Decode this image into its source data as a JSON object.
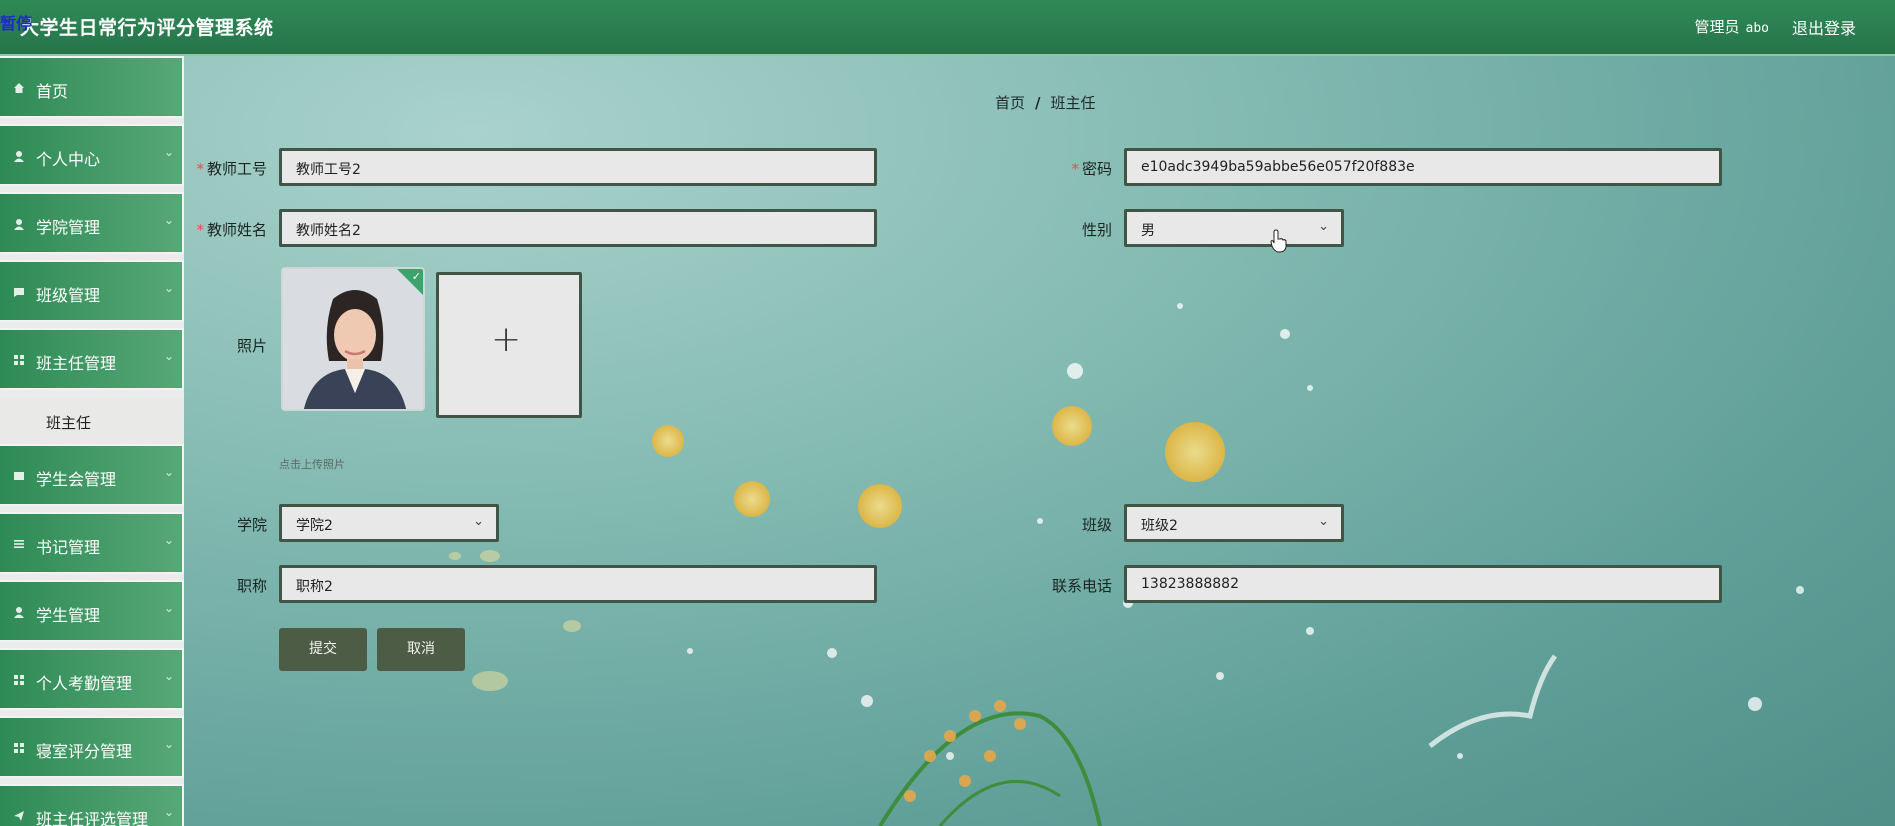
{
  "app": {
    "badge": "暂停",
    "title": "大学生日常行为评分管理系统",
    "user_role": "管理员",
    "user_name": "abo",
    "logout": "退出登录"
  },
  "sidebar": {
    "items": [
      {
        "label": "首页",
        "icon": "home-icon"
      },
      {
        "label": "个人中心",
        "icon": "user-icon"
      },
      {
        "label": "学院管理",
        "icon": "user-icon"
      },
      {
        "label": "班级管理",
        "icon": "chat-icon"
      },
      {
        "label": "班主任管理",
        "icon": "grid-icon"
      },
      {
        "label": "学生会管理",
        "icon": "card-icon"
      },
      {
        "label": "书记管理",
        "icon": "menu-icon"
      },
      {
        "label": "学生管理",
        "icon": "user-icon"
      },
      {
        "label": "个人考勤管理",
        "icon": "grid-icon"
      },
      {
        "label": "寝室评分管理",
        "icon": "grid-icon"
      },
      {
        "label": "班主任评选管理",
        "icon": "send-icon"
      }
    ],
    "sub_item": "班主任"
  },
  "breadcrumb": {
    "home": "首页",
    "separator": "/",
    "current": "班主任"
  },
  "form": {
    "teacher_no": {
      "label": "教师工号",
      "value": "教师工号2"
    },
    "password": {
      "label": "密码",
      "value": "e10adc3949ba59abbe56e057f20f883e"
    },
    "teacher_name": {
      "label": "教师姓名",
      "value": "教师姓名2"
    },
    "gender": {
      "label": "性别",
      "value": "男"
    },
    "photo": {
      "label": "照片",
      "upload_tip": "点击上传照片"
    },
    "college": {
      "label": "学院",
      "value": "学院2"
    },
    "class": {
      "label": "班级",
      "value": "班级2"
    },
    "title": {
      "label": "职称",
      "value": "职称2"
    },
    "phone": {
      "label": "联系电话",
      "value": "13823888882"
    },
    "submit": "提交",
    "cancel": "取消"
  },
  "colors": {
    "header": "#2f8a57",
    "button": "#4d5d45",
    "required": "#e0524d"
  }
}
